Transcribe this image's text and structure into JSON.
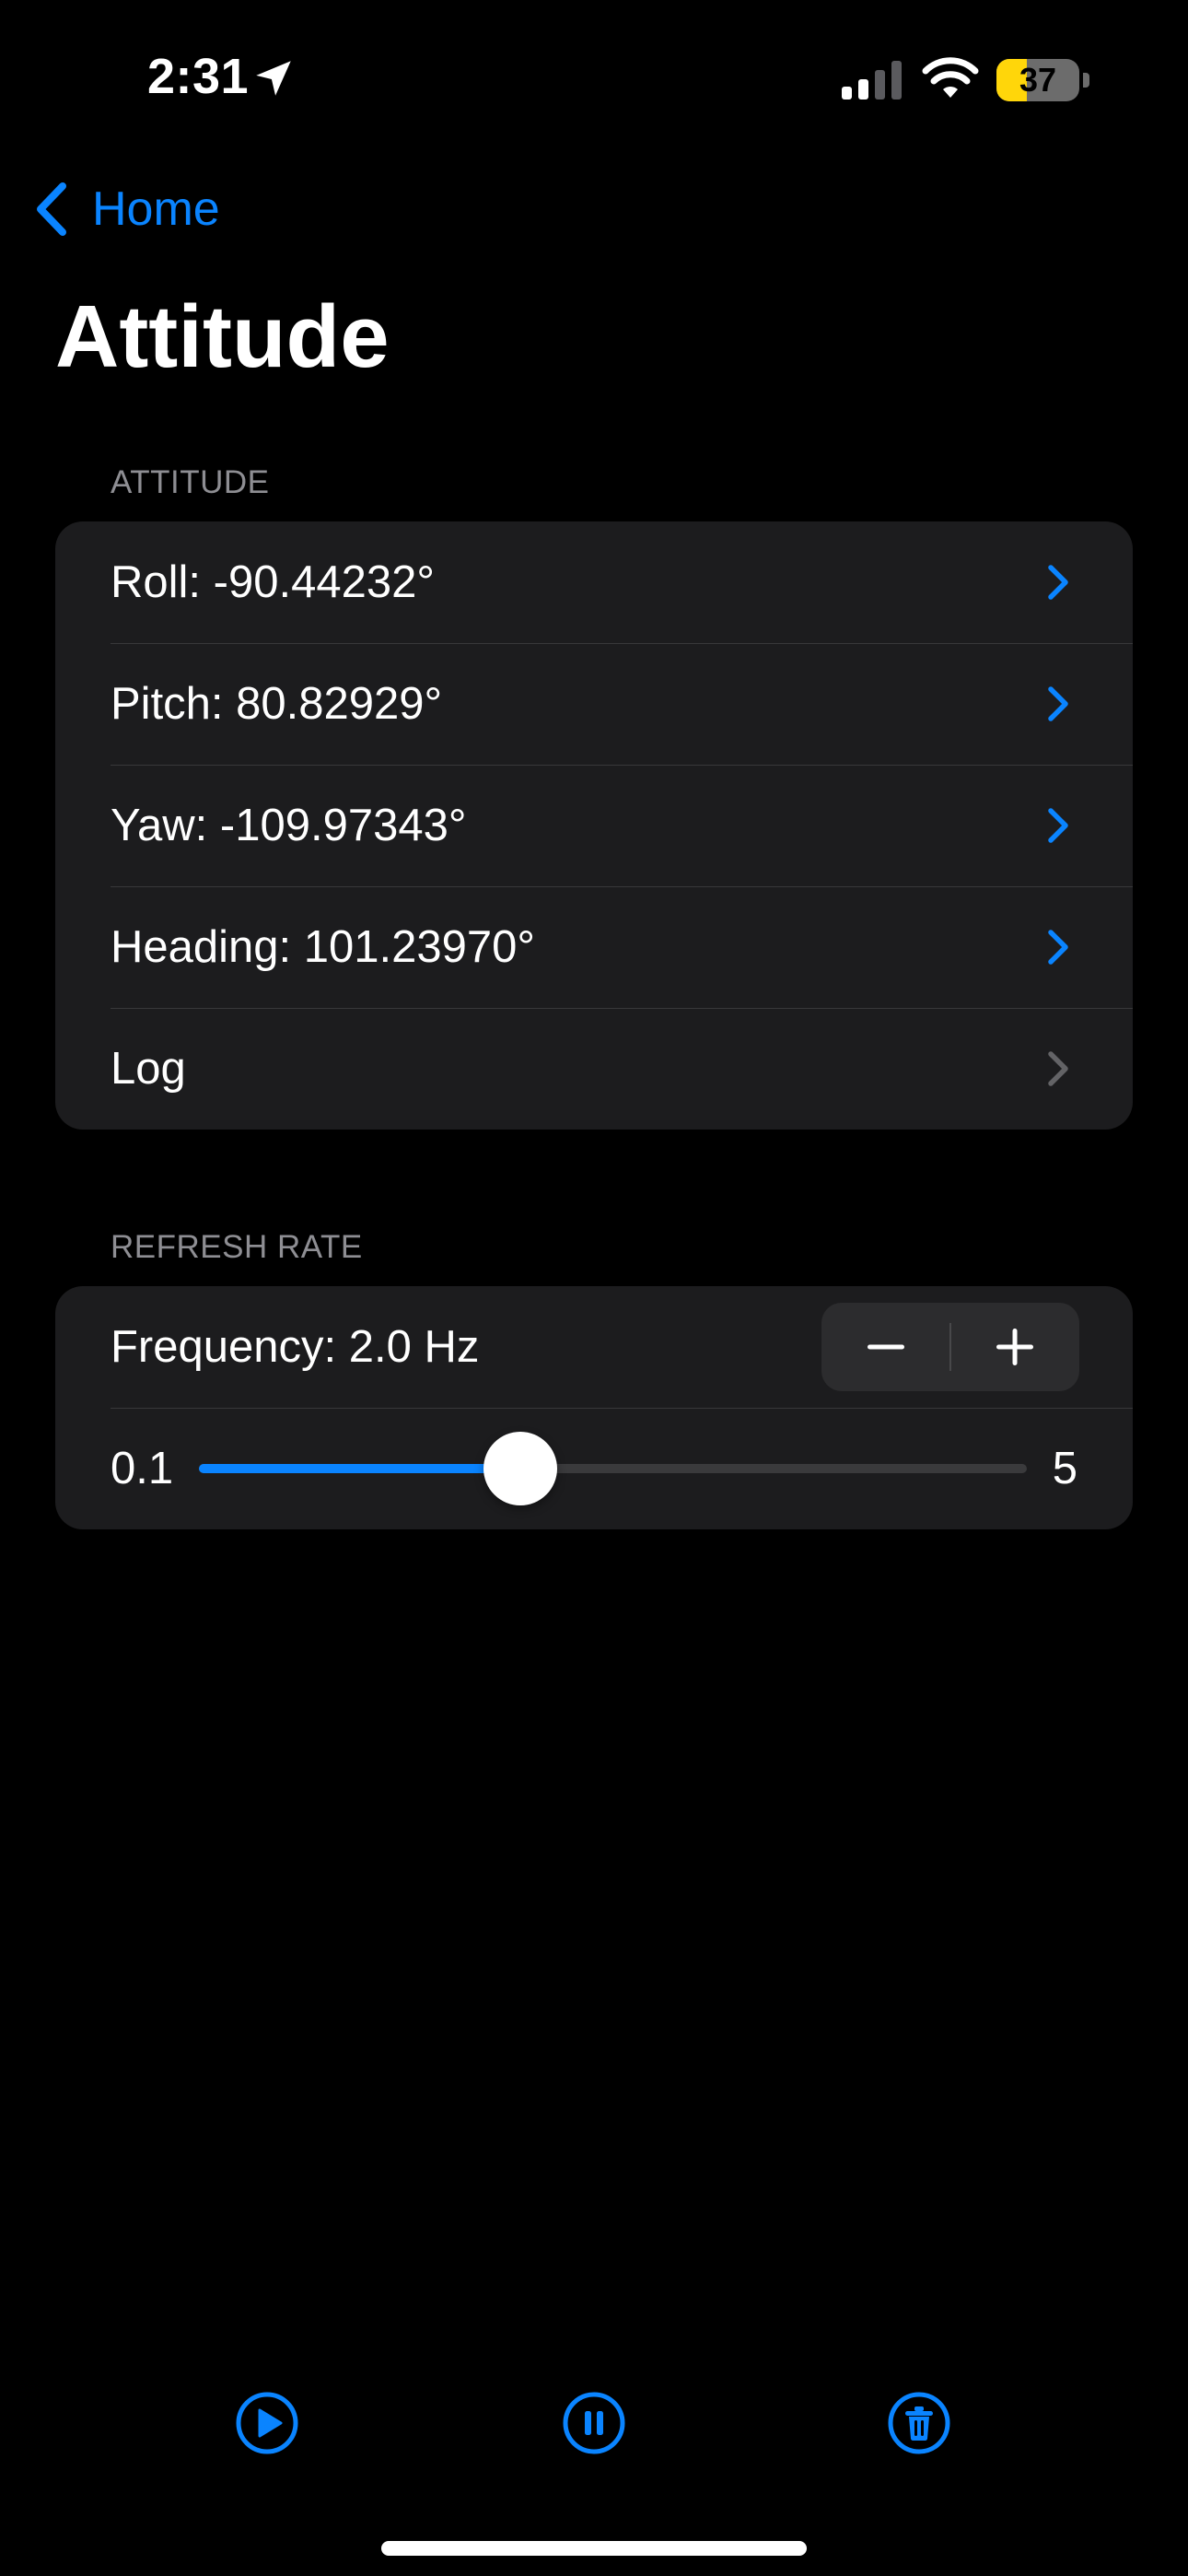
{
  "status_bar": {
    "time": "2:31",
    "battery_level": 37,
    "battery_text": "37",
    "battery_color": "#ffd60a"
  },
  "nav": {
    "back_label": "Home",
    "title": "Attitude"
  },
  "attitude_section": {
    "header": "ATTITUDE",
    "rows": [
      {
        "label": "Roll: -90.44232°"
      },
      {
        "label": "Pitch: 80.82929°"
      },
      {
        "label": "Yaw: -109.97343°"
      },
      {
        "label": "Heading: 101.23970°"
      },
      {
        "label": "Log"
      }
    ]
  },
  "refresh_section": {
    "header": "REFRESH RATE",
    "frequency_label": "Frequency: 2.0 Hz",
    "slider": {
      "min_label": "0.1",
      "max_label": "5",
      "min": 0.1,
      "max": 5,
      "value": 2.0
    }
  },
  "toolbar": {
    "icons": [
      "play-circle-icon",
      "pause-circle-icon",
      "trash-circle-icon"
    ]
  },
  "colors": {
    "accent": "#0a84ff",
    "background": "#000000",
    "card": "#1c1c1e",
    "secondary_text": "#8e8e93",
    "disabled_chevron": "#636366"
  }
}
